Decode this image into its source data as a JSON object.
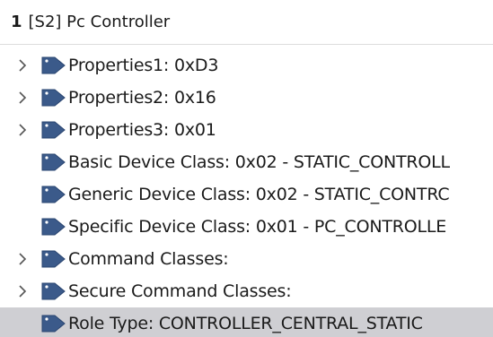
{
  "node": {
    "number": "1",
    "title": "[S2] Pc Controller"
  },
  "items": [
    {
      "label": "Properties1: 0xD3",
      "expandable": true,
      "selected": false
    },
    {
      "label": "Properties2: 0x16",
      "expandable": true,
      "selected": false
    },
    {
      "label": "Properties3: 0x01",
      "expandable": true,
      "selected": false
    },
    {
      "label": "Basic Device Class: 0x02 - STATIC_CONTROLL",
      "expandable": false,
      "selected": false
    },
    {
      "label": "Generic Device Class: 0x02 - STATIC_CONTRC",
      "expandable": false,
      "selected": false
    },
    {
      "label": "Specific Device Class: 0x01 - PC_CONTROLLE",
      "expandable": false,
      "selected": false
    },
    {
      "label": "Command Classes:",
      "expandable": true,
      "selected": false
    },
    {
      "label": "Secure Command Classes:",
      "expandable": true,
      "selected": false
    },
    {
      "label": "Role Type: CONTROLLER_CENTRAL_STATIC",
      "expandable": false,
      "selected": true
    }
  ],
  "colors": {
    "tag_icon": "#3b5a8a",
    "expander": "#555555",
    "selected_row": "#cfcfd3"
  },
  "icons": {
    "expander": "chevron-right-icon",
    "item": "tag-icon"
  }
}
